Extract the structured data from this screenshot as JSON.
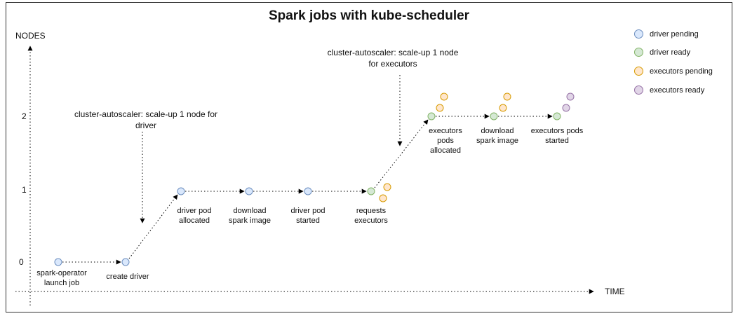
{
  "title": "Spark jobs with kube-scheduler",
  "axes": {
    "y_label": "NODES",
    "x_label": "TIME",
    "y_ticks": [
      "0",
      "1",
      "2"
    ]
  },
  "legend": [
    {
      "label": "driver pending",
      "fill": "#dae8fc",
      "stroke": "#6c8ebf"
    },
    {
      "label": "driver ready",
      "fill": "#d5e8d4",
      "stroke": "#82b366"
    },
    {
      "label": "executors pending",
      "fill": "#ffe6cc",
      "stroke": "#d79b00"
    },
    {
      "label": "executors ready",
      "fill": "#e1d5e7",
      "stroke": "#9673a6"
    }
  ],
  "annotations": {
    "driver_scale_up": "cluster-autoscaler: scale-up 1 node for\ndriver",
    "executors_scale_up": "cluster-autoscaler: scale-up 1 node\nfor executors"
  },
  "steps": [
    {
      "label": "spark-operator\nlaunch job"
    },
    {
      "label": "create driver"
    },
    {
      "label": "driver pod\nallocated"
    },
    {
      "label": "download\nspark image"
    },
    {
      "label": "driver pod\nstarted"
    },
    {
      "label": "requests\nexecutors"
    },
    {
      "label": "executors\npods\nallocated"
    },
    {
      "label": "download\nspark image"
    },
    {
      "label": "executors pods\nstarted"
    }
  ]
}
